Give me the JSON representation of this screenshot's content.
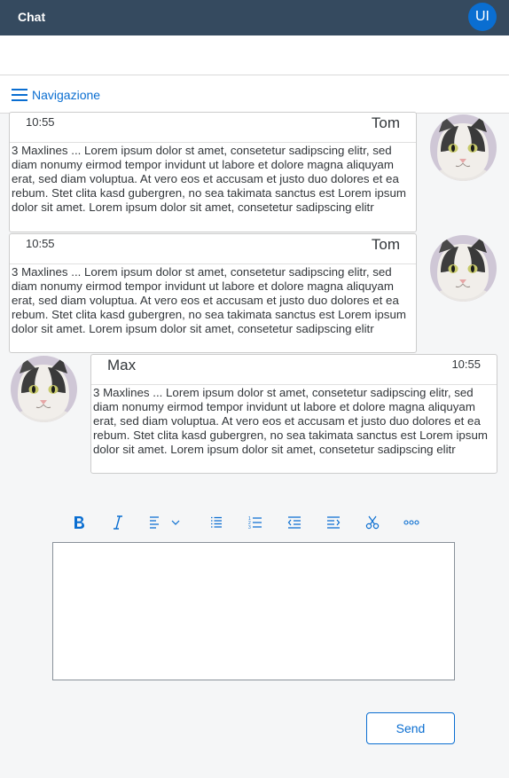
{
  "shell": {
    "title": "Chat",
    "user_initials": "UI"
  },
  "nav": {
    "label": "Navigazione"
  },
  "messages": [
    {
      "time": "10:55",
      "sender": "Tom",
      "text": "3 Maxlines ... Lorem ipsum dolor st amet, consetetur sadipscing elitr, sed diam nonumy eirmod tempor invidunt ut labore et dolore magna aliquyam erat, sed diam voluptua. At vero eos et accusam et justo duo dolores et ea rebum. Stet clita kasd gubergren, no sea takimata sanctus est Lorem ipsum dolor sit amet. Lorem ipsum dolor sit amet, consetetur sadipscing elitr"
    },
    {
      "time": "10:55",
      "sender": "Tom",
      "text": "3 Maxlines ... Lorem ipsum dolor st amet, consetetur sadipscing elitr, sed diam nonumy eirmod tempor invidunt ut labore et dolore magna aliquyam erat, sed diam voluptua. At vero eos et accusam et justo duo dolores et ea rebum. Stet clita kasd gubergren, no sea takimata sanctus est Lorem ipsum dolor sit amet. Lorem ipsum dolor sit amet, consetetur sadipscing elitr"
    },
    {
      "time": "10:55",
      "sender": "Max",
      "text": "3 Maxlines ... Lorem ipsum dolor st amet, consetetur sadipscing elitr, sed diam nonumy eirmod tempor invidunt ut labore et dolore magna aliquyam erat, sed diam voluptua. At vero eos et accusam et justo duo dolores et ea rebum. Stet clita kasd gubergren, no sea takimata sanctus est Lorem ipsum dolor sit amet. Lorem ipsum dolor sit amet, consetetur sadipscing elitr"
    }
  ],
  "toolbar": {
    "icons": [
      "bold-icon",
      "italic-icon",
      "text-align-icon",
      "unordered-list-icon",
      "ordered-list-icon",
      "outdent-icon",
      "indent-icon",
      "cut-icon",
      "overflow-icon"
    ]
  },
  "editor": {
    "value": ""
  },
  "send": {
    "label": "Send"
  },
  "colors": {
    "shell": "#354a5f",
    "accent": "#0a6ed1",
    "background": "#f5f6f7"
  }
}
